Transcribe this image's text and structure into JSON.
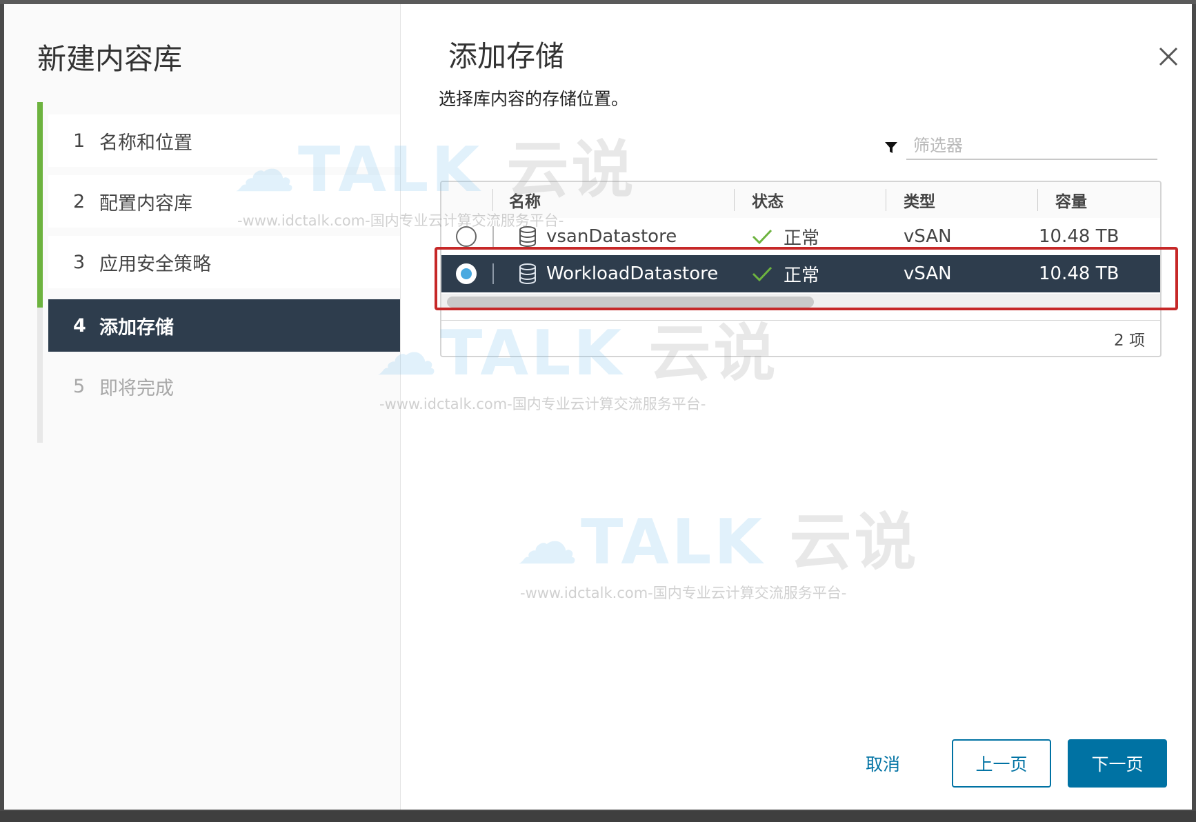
{
  "wizard": {
    "title": "新建内容库",
    "steps": [
      {
        "num": "1",
        "label": "名称和位置",
        "state": "done"
      },
      {
        "num": "2",
        "label": "配置内容库",
        "state": "done"
      },
      {
        "num": "3",
        "label": "应用安全策略",
        "state": "done"
      },
      {
        "num": "4",
        "label": "添加存储",
        "state": "active"
      },
      {
        "num": "5",
        "label": "即将完成",
        "state": "disabled"
      }
    ]
  },
  "page": {
    "title": "添加存储",
    "subtitle": "选择库内容的存储位置。"
  },
  "filter": {
    "placeholder": "筛选器"
  },
  "grid": {
    "columns": [
      "名称",
      "状态",
      "类型",
      "容量"
    ],
    "rows": [
      {
        "name": "vsanDatastore",
        "status": "正常",
        "type": "vSAN",
        "capacity": "10.48 TB",
        "selected": false
      },
      {
        "name": "WorkloadDatastore",
        "status": "正常",
        "type": "vSAN",
        "capacity": "10.48 TB",
        "selected": true
      }
    ],
    "footer": "2 项"
  },
  "buttons": {
    "cancel": "取消",
    "back": "上一页",
    "next": "下一页"
  },
  "watermark": {
    "brand_main": "TALK",
    "brand_cn": "云说",
    "url": "-www.idctalk.com-国内专业云计算交流服务平台-"
  },
  "colors": {
    "accent": "#0072a3",
    "selected_row": "#2e3d4d",
    "step_complete": "#6db33f",
    "status_ok": "#6db33f",
    "highlight": "#c62828"
  },
  "icons": [
    "close-icon",
    "filter-icon",
    "database-icon",
    "check-icon",
    "radio-icon"
  ]
}
